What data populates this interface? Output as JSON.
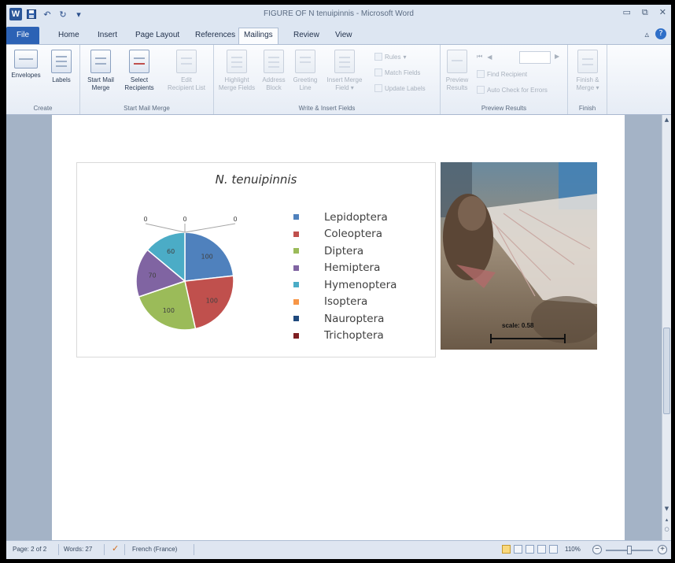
{
  "window": {
    "title": "FIGURE OF N tenuipinnis  -  Microsoft Word",
    "logo_letter": "W"
  },
  "tabs": [
    "File",
    "Home",
    "Insert",
    "Page Layout",
    "References",
    "Mailings",
    "Review",
    "View"
  ],
  "active_tab": "Mailings",
  "ribbon": {
    "create": {
      "label": "Create",
      "envelopes": "Envelopes",
      "labels": "Labels"
    },
    "start_mail_merge": {
      "label": "Start Mail Merge",
      "start_line1": "Start Mail",
      "start_line2": "Merge",
      "select_line1": "Select",
      "select_line2": "Recipients",
      "edit_line1": "Edit",
      "edit_line2": "Recipient List"
    },
    "write_insert": {
      "label": "Write & Insert Fields",
      "highlight_line1": "Highlight",
      "highlight_line2": "Merge Fields",
      "address_line1": "Address",
      "address_line2": "Block",
      "greeting_line1": "Greeting",
      "greeting_line2": "Line",
      "insert_line1": "Insert Merge",
      "insert_line2": "Field",
      "rules": "Rules",
      "match_fields": "Match Fields",
      "update_labels": "Update Labels"
    },
    "preview": {
      "label": "Preview Results",
      "preview_line1": "Preview",
      "preview_line2": "Results",
      "find_recipient": "Find Recipient",
      "auto_check": "Auto Check for Errors"
    },
    "finish": {
      "label": "Finish",
      "finish_line1": "Finish &",
      "finish_line2": "Merge"
    }
  },
  "document": {
    "chart_title": "N. tenuipinnis",
    "photo_scale_label": "scale: 0.58"
  },
  "chart_data": {
    "type": "pie",
    "title": "N. tenuipinnis",
    "categories": [
      "Lepidoptera",
      "Coleoptera",
      "Diptera",
      "Hemiptera",
      "Hymenoptera",
      "Isoptera",
      "Nauroptera",
      "Trichoptera"
    ],
    "values": [
      100,
      100,
      100,
      70,
      60,
      0,
      0,
      0
    ],
    "colors": [
      "#4f81bd",
      "#c0504d",
      "#9bbb59",
      "#8064a2",
      "#4bacc6",
      "#f79646",
      "#1f497d",
      "#7f1f22"
    ],
    "legend_position": "right"
  },
  "status": {
    "page": "Page: 2 of 2",
    "words": "Words: 27",
    "language": "French (France)",
    "zoom": "110%"
  }
}
